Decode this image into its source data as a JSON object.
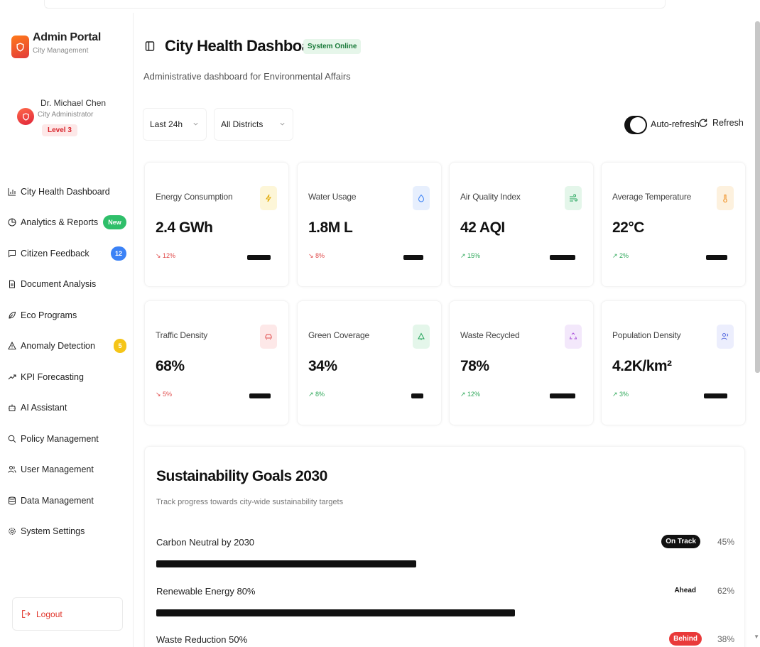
{
  "brand": {
    "title": "Admin Portal",
    "subtitle": "City Management"
  },
  "user": {
    "name": "Dr. Michael Chen",
    "role": "City Administrator",
    "level": "Level 3"
  },
  "nav": [
    {
      "label": "City Health Dashboard",
      "icon": "bar-chart-icon"
    },
    {
      "label": "Analytics & Reports",
      "icon": "pie-chart-icon",
      "badge": "New"
    },
    {
      "label": "Citizen Feedback",
      "icon": "message-icon",
      "badge": "12"
    },
    {
      "label": "Document Analysis",
      "icon": "document-icon"
    },
    {
      "label": "Eco Programs",
      "icon": "leaf-icon"
    },
    {
      "label": "Anomaly Detection",
      "icon": "warning-icon",
      "badge": "5"
    },
    {
      "label": "KPI Forecasting",
      "icon": "trend-up-icon"
    },
    {
      "label": "AI Assistant",
      "icon": "bot-icon"
    },
    {
      "label": "Policy Management",
      "icon": "search-icon"
    },
    {
      "label": "User Management",
      "icon": "users-icon"
    },
    {
      "label": "Data Management",
      "icon": "database-icon"
    },
    {
      "label": "System Settings",
      "icon": "gear-icon"
    }
  ],
  "logout_label": "Logout",
  "header": {
    "title": "City Health Dashboard",
    "status": "System Online",
    "subtitle": "Administrative dashboard for Environmental Affairs"
  },
  "filters": {
    "time_range": "Last 24h",
    "district": "All Districts"
  },
  "controls": {
    "auto_refresh_label": "Auto-refresh",
    "auto_refresh_on": true,
    "refresh_label": "Refresh"
  },
  "kpis": [
    {
      "label": "Energy Consumption",
      "value": "2.4 GWh",
      "change": "12%",
      "direction": "down",
      "icon": "lightning-icon",
      "icon_color": "#e0a800",
      "icon_bg": "#fdf6d8",
      "spark_fill": 0.6
    },
    {
      "label": "Water Usage",
      "value": "1.8M L",
      "change": "8%",
      "direction": "down",
      "icon": "droplet-icon",
      "icon_color": "#3b82f6",
      "icon_bg": "#e7effd",
      "spark_fill": 0.5
    },
    {
      "label": "Air Quality Index",
      "value": "42 AQI",
      "change": "15%",
      "direction": "up",
      "icon": "wind-icon",
      "icon_color": "#22a45a",
      "icon_bg": "#e4f6ea",
      "spark_fill": 0.65
    },
    {
      "label": "Average Temperature",
      "value": "22°C",
      "change": "2%",
      "direction": "up",
      "icon": "thermometer-icon",
      "icon_color": "#f08c1a",
      "icon_bg": "#fdf1de",
      "spark_fill": 0.55
    },
    {
      "label": "Traffic Density",
      "value": "68%",
      "change": "5%",
      "direction": "down",
      "icon": "car-icon",
      "icon_color": "#e04a4a",
      "icon_bg": "#fde8e8",
      "spark_fill": 0.55
    },
    {
      "label": "Green Coverage",
      "value": "34%",
      "change": "8%",
      "direction": "up",
      "icon": "tree-icon",
      "icon_color": "#22a45a",
      "icon_bg": "#e4f6ea",
      "spark_fill": 0.3
    },
    {
      "label": "Waste Recycled",
      "value": "78%",
      "change": "12%",
      "direction": "up",
      "icon": "recycle-icon",
      "icon_color": "#a64ad8",
      "icon_bg": "#f3e8fb",
      "spark_fill": 0.65
    },
    {
      "label": "Population Density",
      "value": "4.2K/km²",
      "change": "3%",
      "direction": "up",
      "icon": "people-icon",
      "icon_color": "#5b6ee0",
      "icon_bg": "#eceefd",
      "spark_fill": 0.6
    }
  ],
  "sustainability": {
    "title": "Sustainability Goals 2030",
    "subtitle": "Track progress towards city-wide sustainability targets",
    "goals": [
      {
        "label": "Carbon Neutral by 2030",
        "status": "On Track",
        "status_kind": "ontrack",
        "percent": "45%",
        "progress": 0.45
      },
      {
        "label": "Renewable Energy 80%",
        "status": "Ahead",
        "status_kind": "ahead",
        "percent": "62%",
        "progress": 0.62
      },
      {
        "label": "Waste Reduction 50%",
        "status": "Behind",
        "status_kind": "behind",
        "percent": "38%",
        "progress": 0.38
      }
    ]
  }
}
